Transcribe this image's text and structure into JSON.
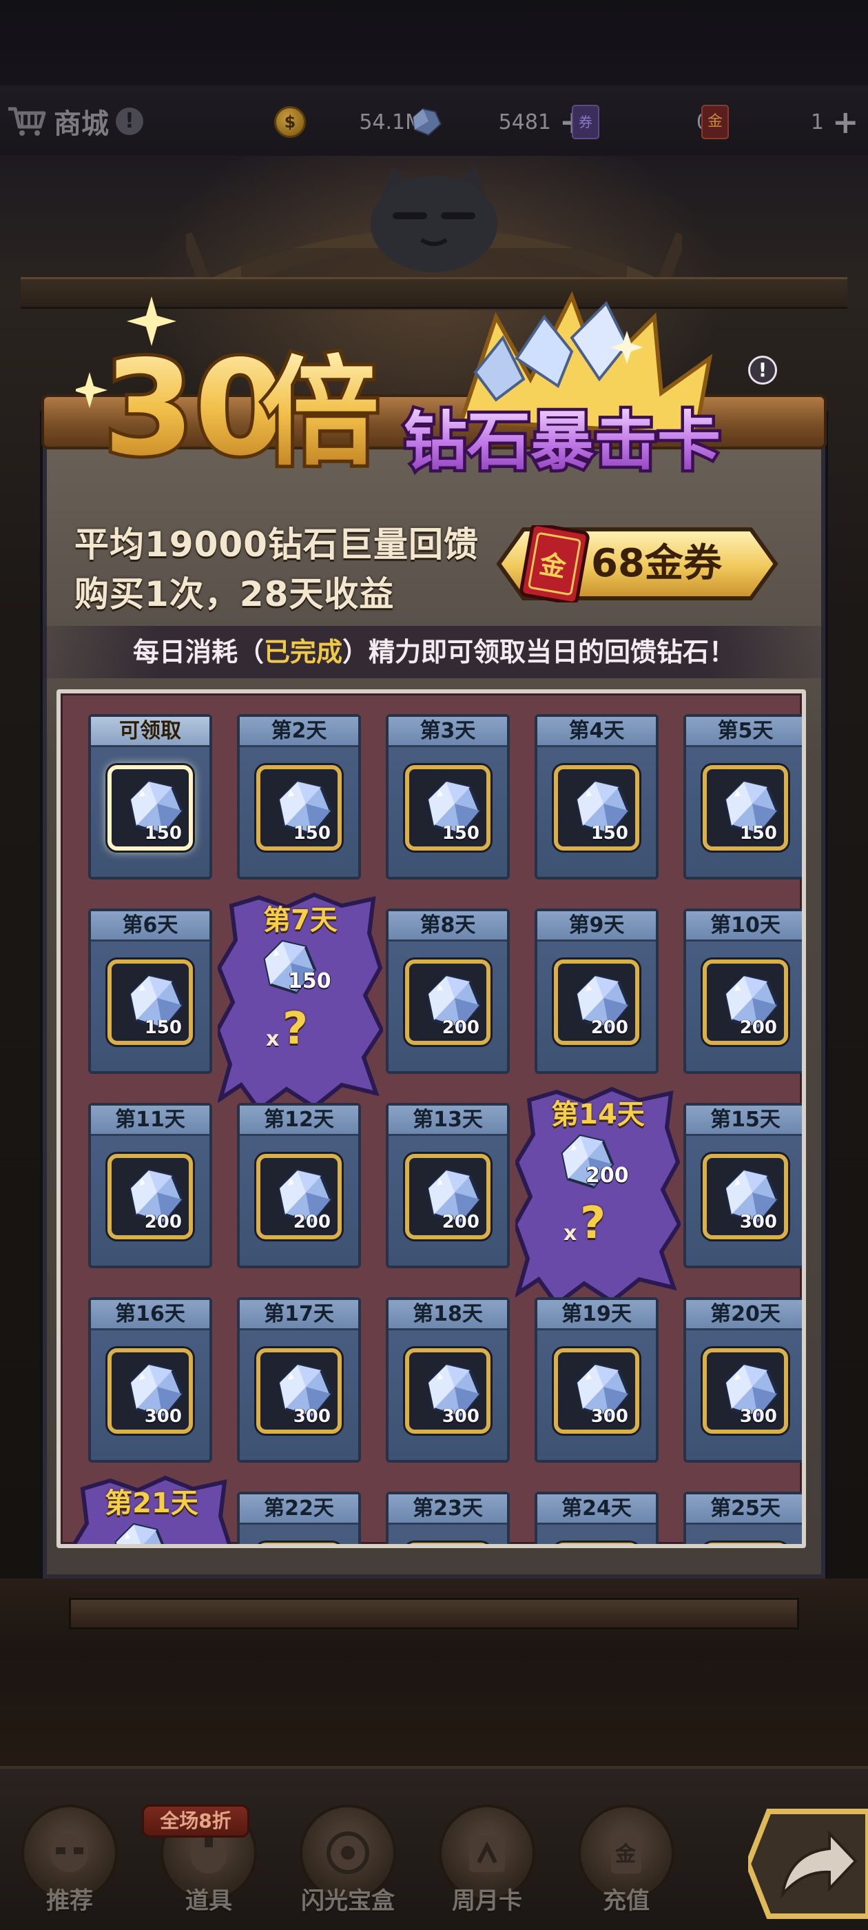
{
  "topbar": {
    "title": "商城",
    "help_icon_text": "!",
    "gold_amount": "54.1M",
    "diamond_amount": "5481",
    "voucher_amount": "0",
    "gold_voucher_amount": "1",
    "plus": "+"
  },
  "banner": {
    "title_icon": "30x-diamond-crit-card-title",
    "info_icon_text": "!",
    "line1": "平均19000钻石巨量回馈",
    "line2": "购买1次，28天收益",
    "price": "68金券",
    "ticket_char": "金",
    "note_prefix": "每日消耗（",
    "note_highlight": "已完成",
    "note_suffix": "）精力即可领取当日的回馈钻石！"
  },
  "days": [
    {
      "label": "可领取",
      "amount": "150",
      "special": false,
      "claimable": true
    },
    {
      "label": "第2天",
      "amount": "150",
      "special": false
    },
    {
      "label": "第3天",
      "amount": "150",
      "special": false
    },
    {
      "label": "第4天",
      "amount": "150",
      "special": false
    },
    {
      "label": "第5天",
      "amount": "150",
      "special": false
    },
    {
      "label": "第6天",
      "amount": "150",
      "special": false
    },
    {
      "label": "第7天",
      "amount": "150",
      "special": true,
      "multiplier": "x",
      "mystery": "?"
    },
    {
      "label": "第8天",
      "amount": "200",
      "special": false
    },
    {
      "label": "第9天",
      "amount": "200",
      "special": false
    },
    {
      "label": "第10天",
      "amount": "200",
      "special": false
    },
    {
      "label": "第11天",
      "amount": "200",
      "special": false
    },
    {
      "label": "第12天",
      "amount": "200",
      "special": false
    },
    {
      "label": "第13天",
      "amount": "200",
      "special": false
    },
    {
      "label": "第14天",
      "amount": "200",
      "special": true,
      "multiplier": "x",
      "mystery": "?"
    },
    {
      "label": "第15天",
      "amount": "300",
      "special": false
    },
    {
      "label": "第16天",
      "amount": "300",
      "special": false
    },
    {
      "label": "第17天",
      "amount": "300",
      "special": false
    },
    {
      "label": "第18天",
      "amount": "300",
      "special": false
    },
    {
      "label": "第19天",
      "amount": "300",
      "special": false
    },
    {
      "label": "第20天",
      "amount": "300",
      "special": false
    },
    {
      "label": "第21天",
      "amount": "",
      "special": true,
      "multiplier": "",
      "mystery": ""
    },
    {
      "label": "第22天",
      "amount": "",
      "special": false
    },
    {
      "label": "第23天",
      "amount": "",
      "special": false
    },
    {
      "label": "第24天",
      "amount": "",
      "special": false
    },
    {
      "label": "第25天",
      "amount": "",
      "special": false
    }
  ],
  "bottom_nav": {
    "sale_badge": "全场8折",
    "items": [
      {
        "label": "推荐",
        "icon": "recommend-icon"
      },
      {
        "label": "道具",
        "icon": "items-icon"
      },
      {
        "label": "闪光宝盒",
        "icon": "shiny-box-icon"
      },
      {
        "label": "周月卡",
        "icon": "weekly-monthly-card-icon"
      },
      {
        "label": "充值",
        "icon": "recharge-icon"
      }
    ],
    "share_icon": "share-arrow-icon"
  },
  "colors": {
    "grid_bg": "#6a3e46",
    "cell_bg": "#4a5f83",
    "gold_text": "#f5cf4a",
    "special_burst": "#6a4aa8",
    "highlight": "#f1c94a"
  }
}
